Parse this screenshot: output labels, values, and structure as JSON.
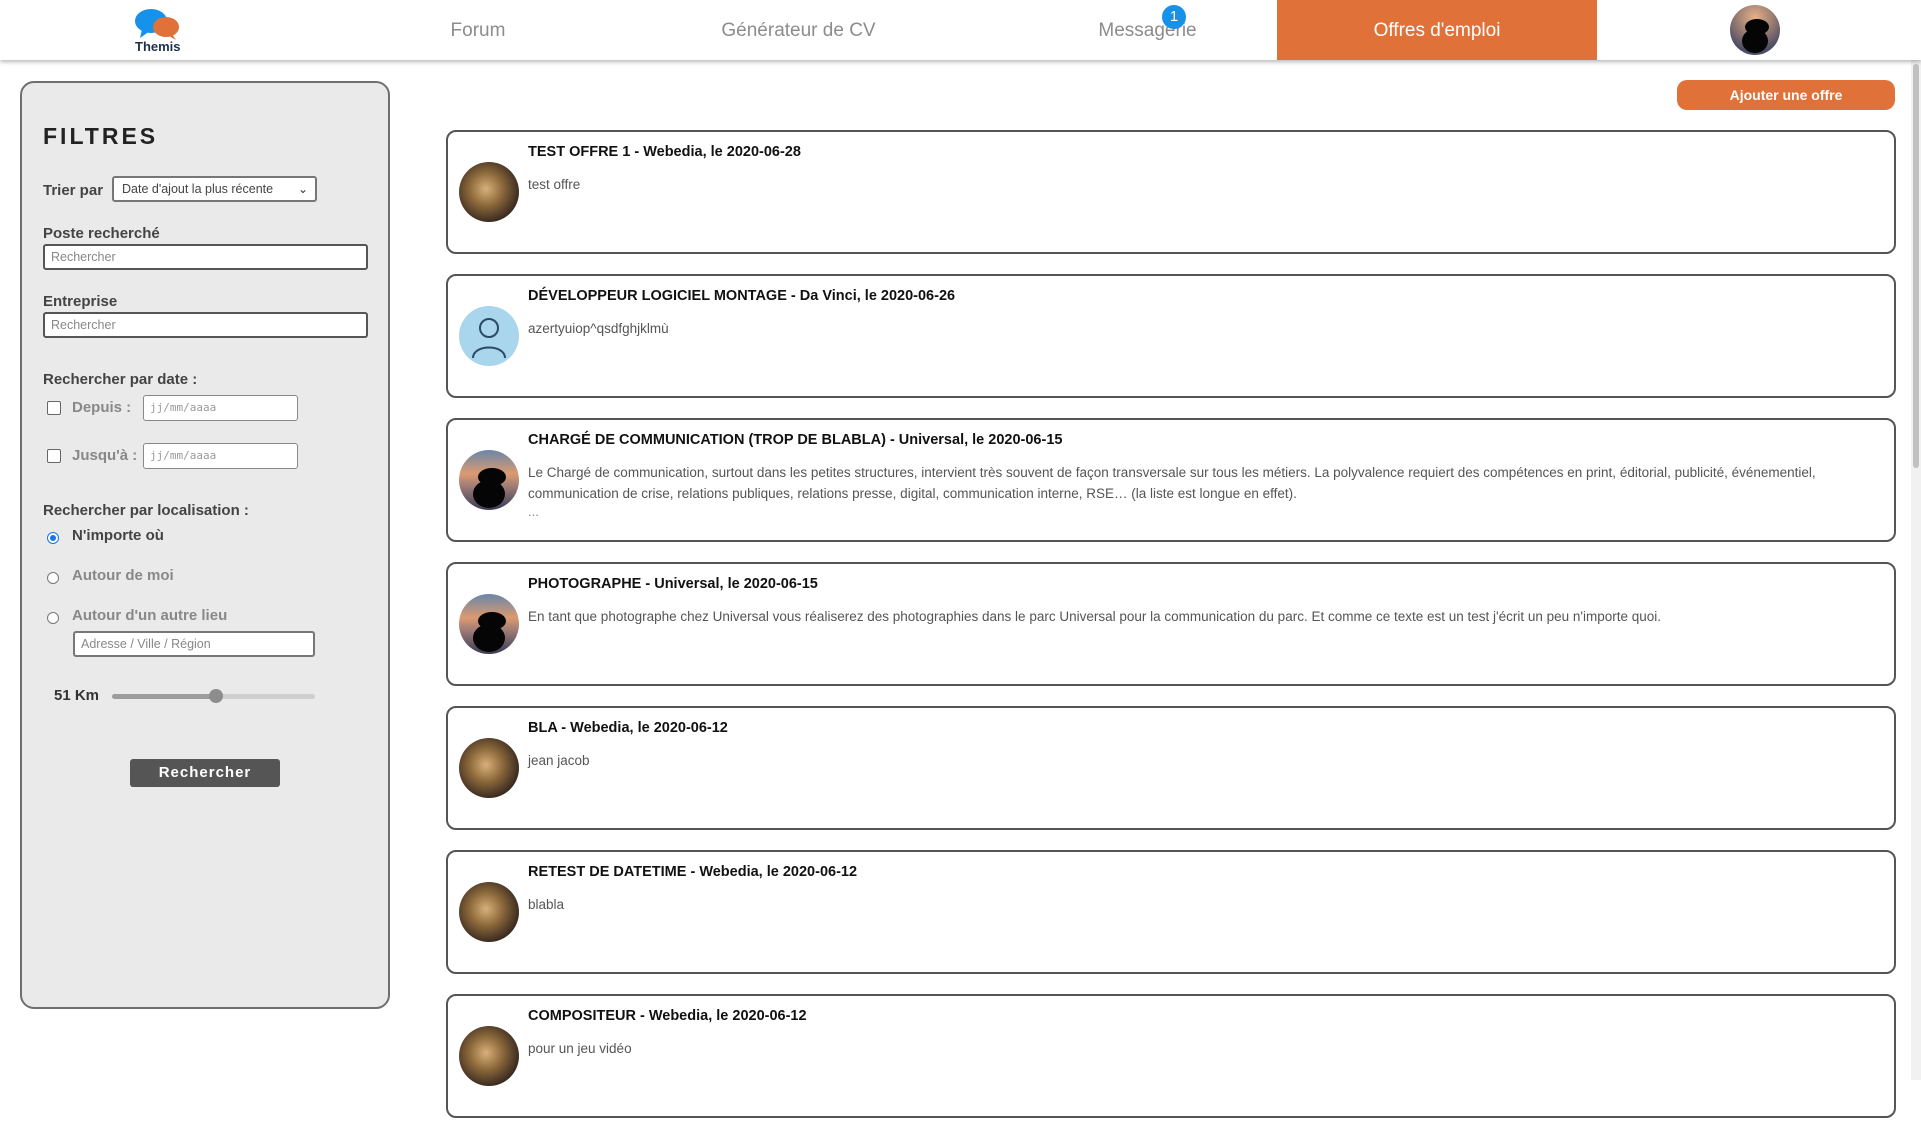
{
  "header": {
    "logo_text": "Themis",
    "nav": {
      "forum": "Forum",
      "cv": "Générateur de CV",
      "messages": "Messagerie",
      "messages_badge": "1",
      "jobs": "Offres d'emploi"
    },
    "accent_color": "#e07138"
  },
  "filters": {
    "title": "FILTRES",
    "sort_label": "Trier par",
    "sort_value": "Date d'ajout la plus récente",
    "position_label": "Poste recherché",
    "position_placeholder": "Rechercher",
    "company_label": "Entreprise",
    "company_placeholder": "Rechercher",
    "date_section_label": "Rechercher par date :",
    "since_label": "Depuis :",
    "since_placeholder": "jj/mm/aaaa",
    "until_label": "Jusqu'à :",
    "until_placeholder": "jj/mm/aaaa",
    "location_section_label": "Rechercher par localisation :",
    "location_options": [
      "N'importe où",
      "Autour de moi",
      "Autour d'un autre lieu"
    ],
    "location_selected": "N'importe où",
    "address_placeholder": "Adresse / Ville / Région",
    "distance_label": "51 Km",
    "distance_fraction": 0.51,
    "search_button": "Rechercher"
  },
  "main": {
    "add_offer_button": "Ajouter une offre",
    "offers": [
      {
        "title": "TEST OFFRE 1",
        "meta": " - Webedia, le 2020-06-28",
        "description": "test offre",
        "more": "",
        "avatar": "av-photo"
      },
      {
        "title": "DÉVELOPPEUR LOGICIEL MONTAGE",
        "meta": " - Da Vinci, le 2020-06-26",
        "description": "azertyuiop^qsdfghjklmù",
        "more": "",
        "avatar": "av-default"
      },
      {
        "title": "CHARGÉ DE COMMUNICATION (TROP DE BLABLA)",
        "meta": " - Universal, le 2020-06-15",
        "description": "Le Chargé de communication, surtout dans les petites structures, intervient très souvent de façon transversale sur tous les métiers. La polyvalence requiert des compétences en print, éditorial, publicité, événementiel, communication de crise, relations publiques, relations presse, digital, communication interne, RSE… (la liste est longue en effet).",
        "more": "...",
        "avatar": "av-sunset"
      },
      {
        "title": "PHOTOGRAPHE",
        "meta": " - Universal, le 2020-06-15",
        "description": "En tant que photographe chez Universal vous réaliserez des photographies dans le parc Universal pour la communication du parc. Et comme ce texte est un test j'écrit un peu n'importe quoi.",
        "more": "",
        "avatar": "av-sunset"
      },
      {
        "title": "BLA",
        "meta": " - Webedia, le 2020-06-12",
        "description": "jean jacob",
        "more": "",
        "avatar": "av-photo"
      },
      {
        "title": "RETEST DE DATETIME",
        "meta": " - Webedia, le 2020-06-12",
        "description": "blabla",
        "more": "",
        "avatar": "av-photo"
      },
      {
        "title": "COMPOSITEUR",
        "meta": " - Webedia, le 2020-06-12",
        "description": "pour un jeu vidéo",
        "more": "",
        "avatar": "av-photo"
      }
    ]
  }
}
